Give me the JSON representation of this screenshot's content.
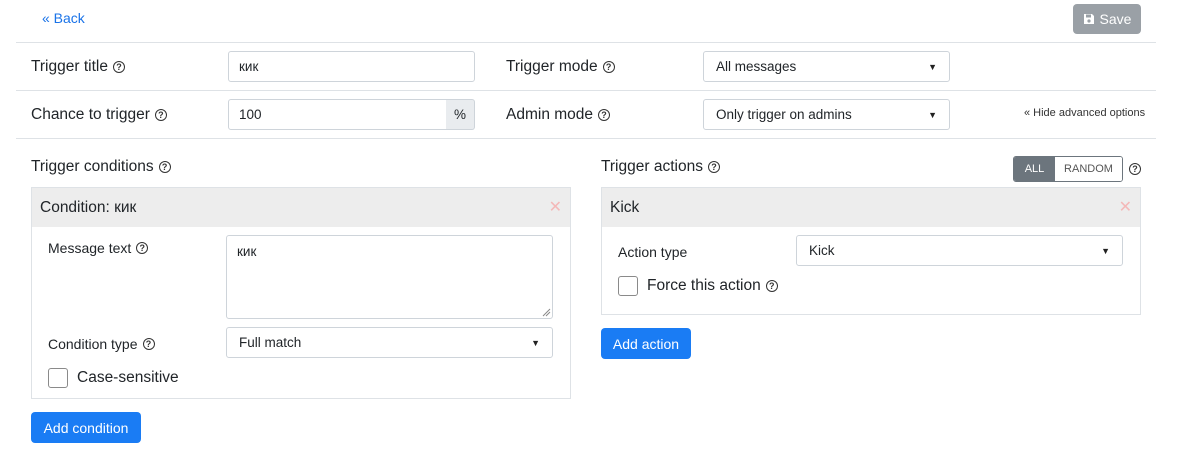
{
  "header": {
    "back_label": "« Back",
    "save_label": "Save"
  },
  "settings": {
    "trigger_title_label": "Trigger title",
    "trigger_title_value": "кик",
    "trigger_mode_label": "Trigger mode",
    "trigger_mode_value": "All messages",
    "chance_label": "Chance to trigger",
    "chance_value": "100",
    "chance_unit": "%",
    "admin_mode_label": "Admin mode",
    "admin_mode_value": "Only trigger on admins",
    "hide_advanced": "« Hide advanced options"
  },
  "conditions": {
    "heading": "Trigger conditions",
    "panel_title": "Condition: кик",
    "message_text_label": "Message text",
    "message_text_value": "кик",
    "condition_type_label": "Condition type",
    "condition_type_value": "Full match",
    "case_sensitive_label": "Case-sensitive",
    "add_label": "Add condition"
  },
  "actions": {
    "heading": "Trigger actions",
    "toggle_all": "ALL",
    "toggle_random": "RANDOM",
    "panel_title": "Kick",
    "action_type_label": "Action type",
    "action_type_value": "Kick",
    "force_label": "Force this action",
    "add_label": "Add action"
  },
  "icons": {
    "help": "question-circle-icon",
    "remove": "close-icon",
    "save": "floppy-disk-icon",
    "dropdown": "caret-down-icon"
  },
  "colors": {
    "primary": "#1a7cf4",
    "save_disabled": "#9aa0a6",
    "panel_header": "#ededed",
    "remove_icon": "#f4b8b8",
    "toggle_active": "#6c757d"
  }
}
